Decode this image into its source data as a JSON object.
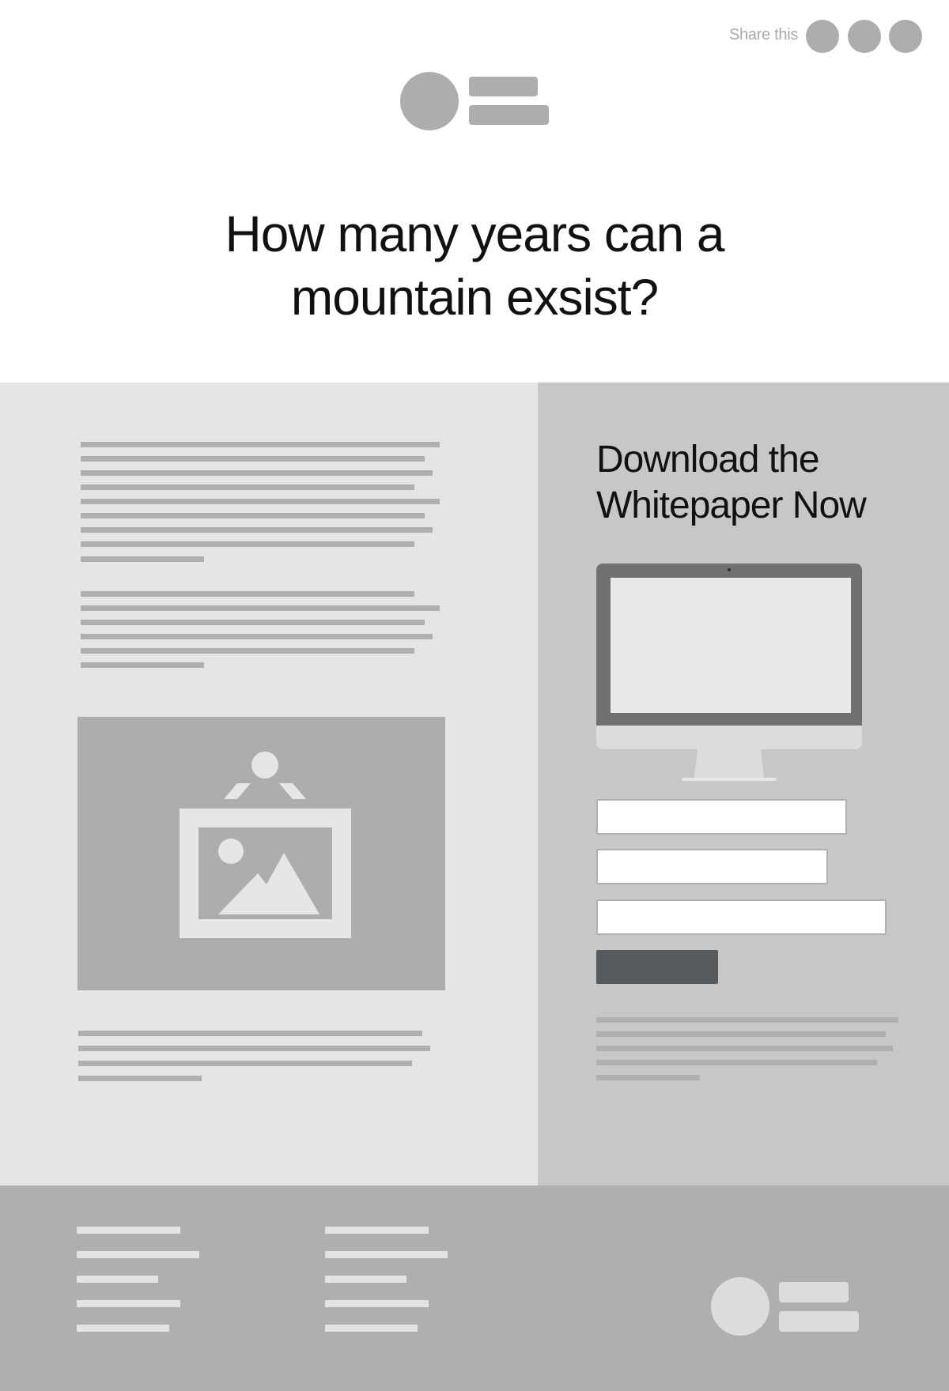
{
  "header": {
    "share_label": "Share this",
    "share_buttons": [
      "share-button-1",
      "share-button-2",
      "share-button-3"
    ]
  },
  "hero": {
    "title_line1": "How many years can a",
    "title_line2": "mountain exsist?"
  },
  "sidebar": {
    "title_line1": "Download the",
    "title_line2": "Whitepaper Now",
    "form": {
      "field1_value": "",
      "field2_value": "",
      "field3_value": "",
      "submit_label": ""
    }
  },
  "colors": {
    "page_bg": "#ffffff",
    "content_bg": "#e5e5e5",
    "sidebar_bg": "#c7c7c7",
    "footer_bg": "#afafaf",
    "placeholder_gray": "#adadad",
    "button_dark": "#575a5c"
  },
  "icons": {
    "share": "share-icon",
    "logo": "logo-icon",
    "image": "image-placeholder-icon",
    "monitor": "monitor-icon"
  }
}
